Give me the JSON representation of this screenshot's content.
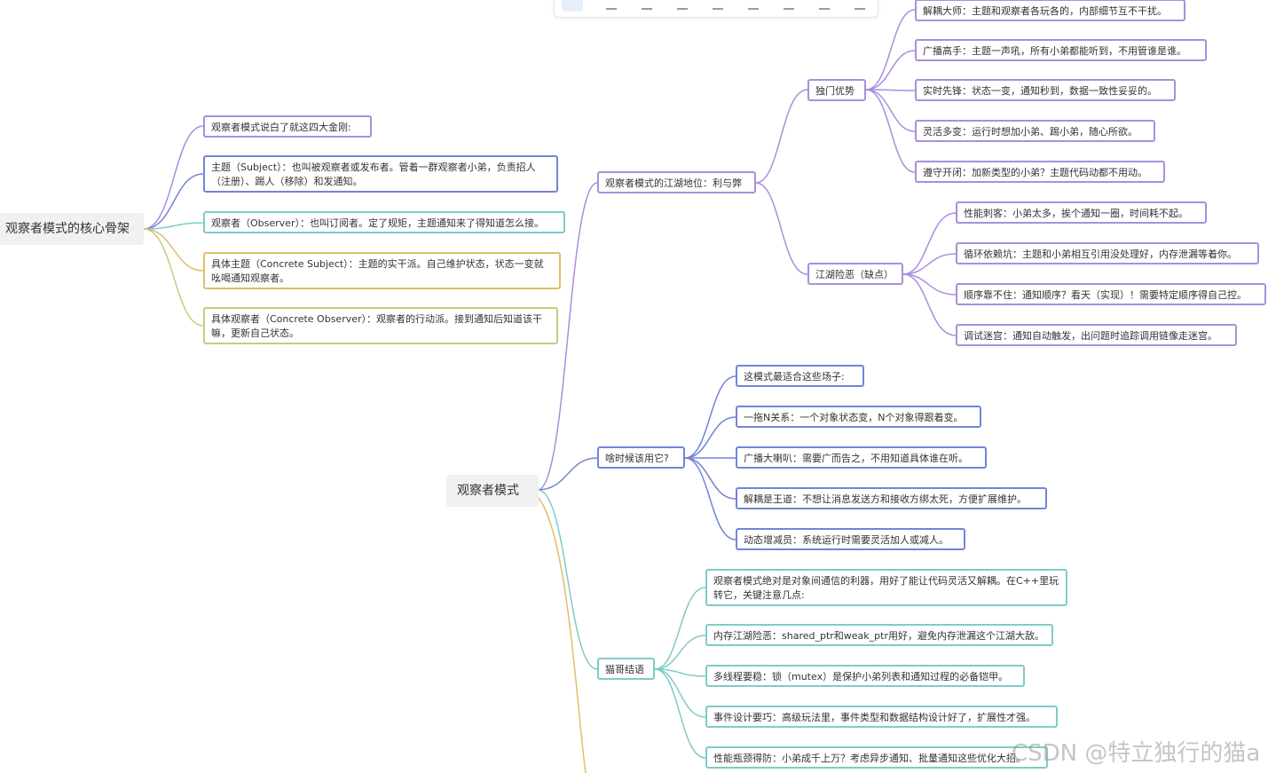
{
  "central": {
    "label": "观察者模式"
  },
  "left_topic": {
    "label": "观察者模式的核心骨架",
    "children": [
      "观察者模式说白了就这四大金刚:",
      "主题（Subject）：也叫被观察者或发布者。管着一群观察者小弟，负责招人（注册）、踢人（移除）和发通知。",
      "观察者（Observer）：也叫订阅者。定了规矩，主题通知来了得知道怎么接。",
      "具体主题（Concrete Subject）：主题的实干派。自己维护状态，状态一变就吆喝通知观察者。",
      "具体观察者（Concrete Observer）：观察者的行动派。接到通知后知道该干嘛，更新自己状态。"
    ]
  },
  "branch_status": {
    "label": "观察者模式的江湖地位：利与弊",
    "pros": {
      "label": "独门优势",
      "items": [
        "解耦大师：主题和观察者各玩各的，内部细节互不干扰。",
        "广播高手：主题一声吼，所有小弟都能听到，不用管谁是谁。",
        "实时先锋：状态一变，通知秒到，数据一致性妥妥的。",
        "灵活多变：运行时想加小弟、踢小弟，随心所欲。",
        "遵守开闭：加新类型的小弟？主题代码动都不用动。"
      ]
    },
    "cons": {
      "label": "江湖险恶（缺点）",
      "items": [
        "性能刺客：小弟太多，挨个通知一圈，时间耗不起。",
        "循环依赖坑：主题和小弟相互引用没处理好，内存泄漏等着你。",
        "顺序靠不住：通知顺序？看天（实现）！需要特定顺序得自己控。",
        "调试迷宫：通知自动触发，出问题时追踪调用链像走迷宫。"
      ]
    }
  },
  "branch_when": {
    "label": "啥时候该用它?",
    "items": [
      "这模式最适合这些场子:",
      "一拖N关系：一个对象状态变，N个对象得跟着变。",
      "广播大喇叭：需要广而告之，不用知道具体谁在听。",
      "解耦是王道：不想让消息发送方和接收方绑太死，方便扩展维护。",
      "动态增减员：系统运行时需要灵活加人或减人。"
    ]
  },
  "branch_summary": {
    "label": "猫哥结语",
    "items": [
      "观察者模式绝对是对象间通信的利器，用好了能让代码灵活又解耦。在C++里玩转它，关键注意几点:",
      "内存江湖险恶：shared_ptr和weak_ptr用好，避免内存泄漏这个江湖大敌。",
      "多线程要稳：锁（mutex）是保护小弟列表和通知过程的必备铠甲。",
      "事件设计要巧：高级玩法里，事件类型和数据结构设计好了，扩展性才强。",
      "性能瓶颈得防：小弟成千上万？考虑异步通知、批量通知这些优化大招。"
    ]
  },
  "watermark": "CSDN @特立独行的猫a",
  "colors": {
    "purple": "#a98fdc",
    "blue": "#7484d8",
    "teal": "#7fcbc7",
    "gold": "#e1bd6a",
    "olive": "#c4ce7b"
  }
}
